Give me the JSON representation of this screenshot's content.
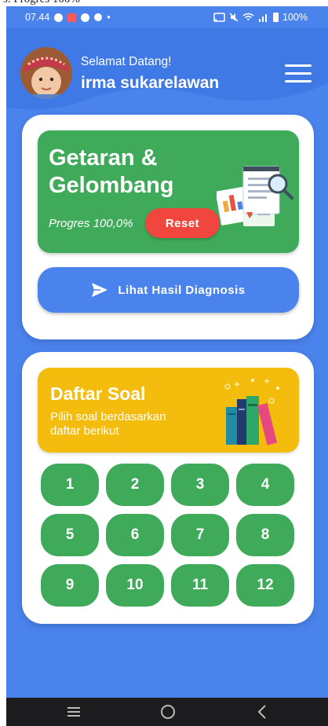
{
  "top_cut_text": "s. Progres 100%",
  "status_bar": {
    "time": "07.44",
    "battery": "100%"
  },
  "header": {
    "greeting": "Selamat Datang!",
    "username": "irma sukarelawan"
  },
  "topic_card": {
    "title_line1": "Getaran &",
    "title_line2": "Gelombang",
    "progress_text": "Progres 100,0%",
    "reset_label": "Reset",
    "diagnosis_label": "Lihat Hasil Diagnosis"
  },
  "soal_card": {
    "title": "Daftar Soal",
    "subtitle": "Pilih soal berdasarkan daftar berikut",
    "numbers": [
      "1",
      "2",
      "3",
      "4",
      "5",
      "6",
      "7",
      "8",
      "9",
      "10",
      "11",
      "12"
    ]
  },
  "colors": {
    "primary_blue": "#4a83ec",
    "green": "#3eaa5a",
    "yellow": "#f4bc0c",
    "reset_red": "#f0463e"
  },
  "icons": {
    "menu": "hamburger-menu-icon",
    "send": "paper-plane-icon",
    "nav": [
      "recent-apps-icon",
      "home-icon",
      "back-icon"
    ]
  }
}
